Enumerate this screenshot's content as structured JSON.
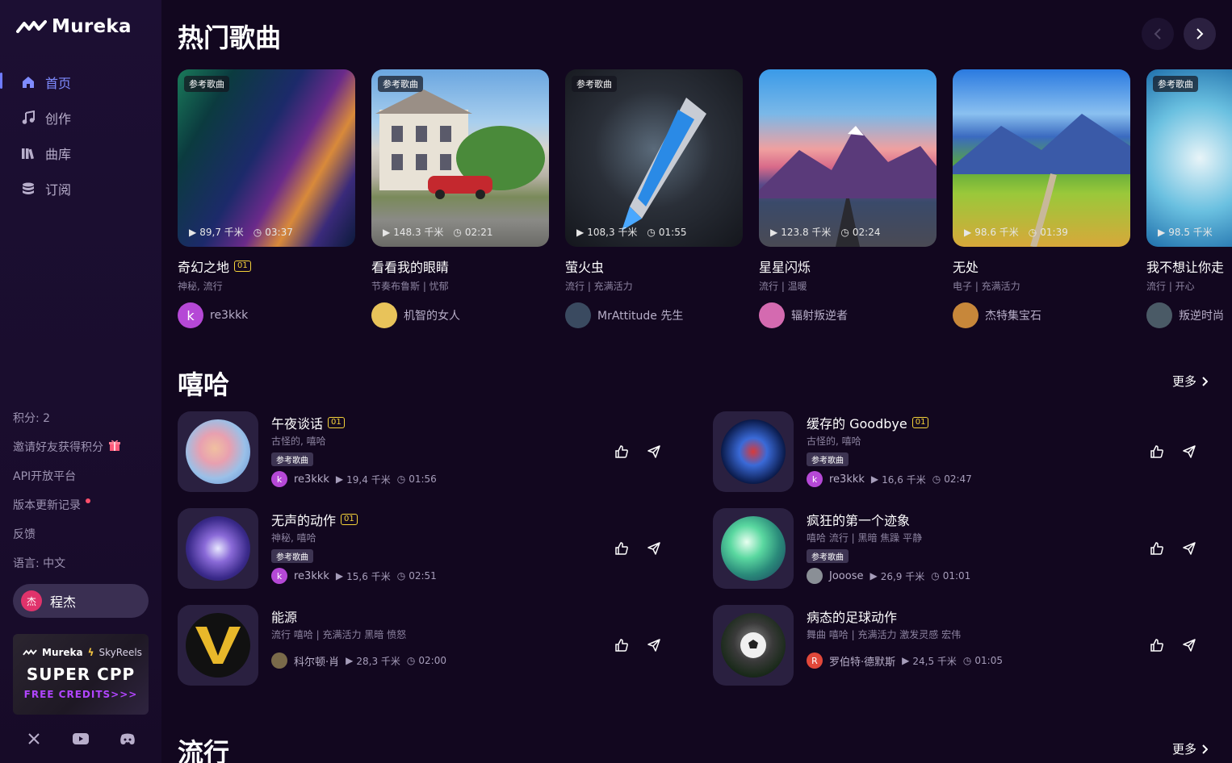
{
  "brand": {
    "name": "Mureka"
  },
  "nav": [
    {
      "label": "首页",
      "icon": "home-icon",
      "active": true
    },
    {
      "label": "创作",
      "icon": "music-note-icon",
      "active": false
    },
    {
      "label": "曲库",
      "icon": "library-icon",
      "active": false
    },
    {
      "label": "订阅",
      "icon": "coins-icon",
      "active": false
    }
  ],
  "sidebar_links": {
    "points": "积分: 2",
    "invite": "邀请好友获得积分",
    "api": "API开放平台",
    "changelog": "版本更新记录",
    "feedback": "反馈",
    "language": "语言:  中文"
  },
  "user": {
    "avatar_char": "杰",
    "name": "程杰"
  },
  "promo": {
    "brand1": "Mureka",
    "brand2": "SkyReels",
    "title": "SUPER CPP",
    "subtitle": "FREE CREDITS>>>"
  },
  "socials": [
    "x-icon",
    "youtube-icon",
    "discord-icon"
  ],
  "hot": {
    "title": "热门歌曲",
    "cards": [
      {
        "badge": "参考歌曲",
        "plays": "89,7 千米",
        "duration": "03:37",
        "title": "奇幻之地",
        "version": "01",
        "tags": "神秘,  流行",
        "author": "re3kkk",
        "avatar_char": "k",
        "avatar_color": "#b548d6"
      },
      {
        "badge": "参考歌曲",
        "plays": "148.3 千米",
        "duration": "02:21",
        "title": "看看我的眼睛",
        "version": "",
        "tags": "节奏布鲁斯 | 忧郁",
        "author": "机智的女人",
        "avatar_char": "",
        "avatar_color": "#e8c35a"
      },
      {
        "badge": "参考歌曲",
        "plays": "108,3 千米",
        "duration": "01:55",
        "title": "萤火虫",
        "version": "",
        "tags": "流行 | 充满活力",
        "author": "MrAttitude 先生",
        "avatar_char": "",
        "avatar_color": "#3a4a60"
      },
      {
        "badge": "",
        "plays": "123.8 千米",
        "duration": "02:24",
        "title": "星星闪烁",
        "version": "",
        "tags": "流行 | 温暖",
        "author": "辐射叛逆者",
        "avatar_char": "",
        "avatar_color": "#d46ab0"
      },
      {
        "badge": "",
        "plays": "98.6 千米",
        "duration": "01:39",
        "title": "无处",
        "version": "",
        "tags": "电子 | 充满活力",
        "author": "杰特集宝石",
        "avatar_char": "",
        "avatar_color": "#c7873a"
      },
      {
        "badge": "参考歌曲",
        "plays": "98.5 千米",
        "duration": "",
        "title": "我不想让你走",
        "version": "",
        "tags": "流行 | 开心",
        "author": "叛逆时尚",
        "avatar_char": "",
        "avatar_color": "#4a5a66"
      }
    ]
  },
  "hiphop": {
    "title": "嘻哈",
    "more": "更多",
    "songs": [
      {
        "title": "午夜谈话",
        "version": "01",
        "tags": "古怪的,  嘻哈",
        "ref": "参考歌曲",
        "author": "re3kkk",
        "avatar_char": "k",
        "avatar_color": "#b548d6",
        "plays": "19,4 千米",
        "duration": "01:56"
      },
      {
        "title": "缓存的 Goodbye",
        "version": "01",
        "tags": "古怪的,  嘻哈",
        "ref": "参考歌曲",
        "author": "re3kkk",
        "avatar_char": "k",
        "avatar_color": "#b548d6",
        "plays": "16,6 千米",
        "duration": "02:47"
      },
      {
        "title": "无声的动作",
        "version": "01",
        "tags": "神秘,  嘻哈",
        "ref": "参考歌曲",
        "author": "re3kkk",
        "avatar_char": "k",
        "avatar_color": "#b548d6",
        "plays": "15,6 千米",
        "duration": "02:51"
      },
      {
        "title": "疯狂的第一个迹象",
        "version": "",
        "tags": "嘻哈 流行 | 黑暗 焦躁 平静",
        "ref": "参考歌曲",
        "author": "Jooose",
        "avatar_char": "",
        "avatar_color": "#8a8f96",
        "plays": "26,9 千米",
        "duration": "01:01"
      },
      {
        "title": "能源",
        "version": "",
        "tags": "流行 嘻哈 | 充满活力 黑暗 愤怒",
        "ref": "",
        "author": "科尔顿·肖",
        "avatar_char": "",
        "avatar_color": "#7a6a4a",
        "plays": "28,3 千米",
        "duration": "02:00"
      },
      {
        "title": "病态的足球动作",
        "version": "",
        "tags": "舞曲 嘻哈 | 充满活力 激发灵感 宏伟",
        "ref": "",
        "author": "罗伯特·德默斯",
        "avatar_char": "R",
        "avatar_color": "#e2483a",
        "plays": "24,5 千米",
        "duration": "01:05"
      }
    ]
  },
  "pop": {
    "title": "流行",
    "more": "更多"
  }
}
